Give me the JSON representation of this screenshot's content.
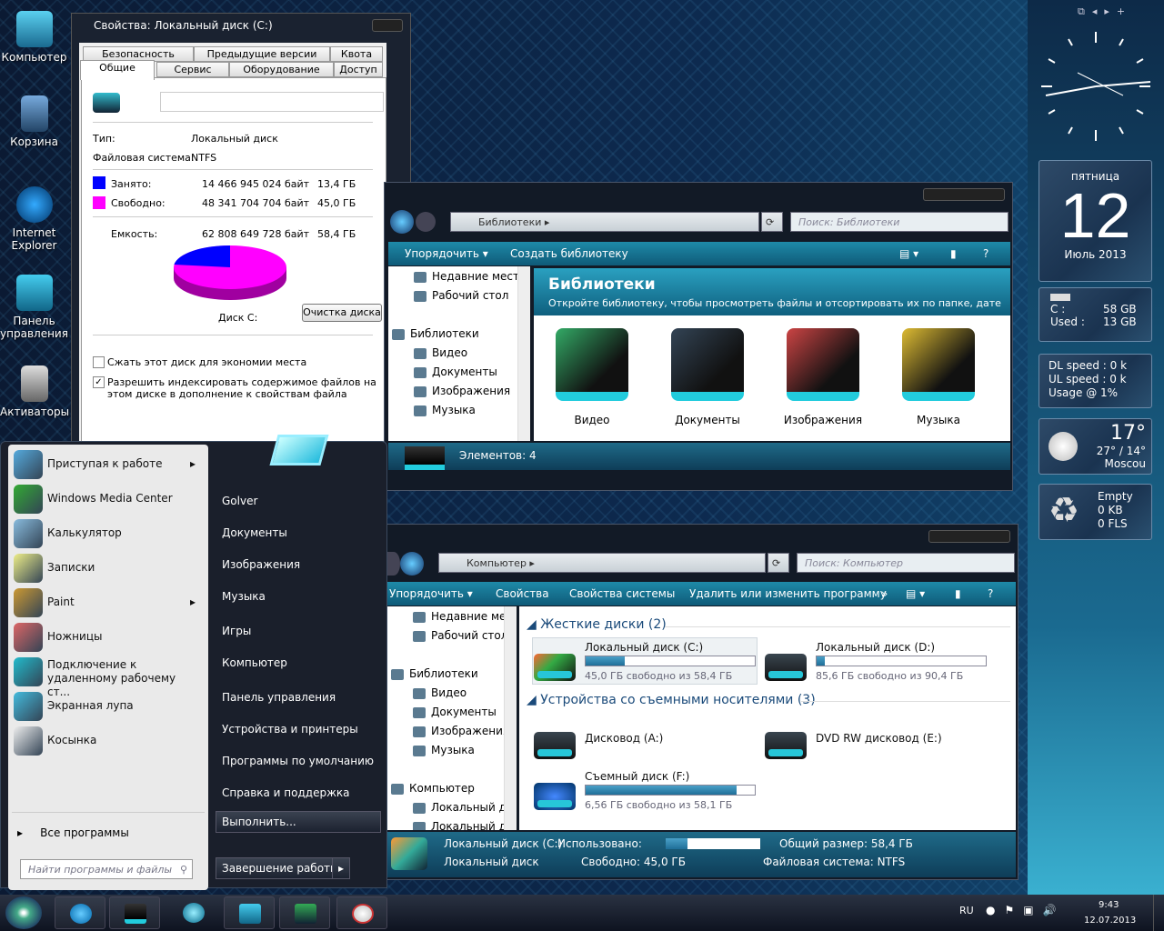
{
  "desktop": {
    "icons": [
      {
        "label": "Компьютер"
      },
      {
        "label": "Корзина"
      },
      {
        "label": "Internet Explorer"
      },
      {
        "label": "Панель управления"
      },
      {
        "label": "Активаторы"
      }
    ]
  },
  "props": {
    "title": "Свойства: Локальный диск (C:)",
    "tabs_top": [
      "Безопасность",
      "Предыдущие версии",
      "Квота"
    ],
    "tabs_bottom": [
      "Общие",
      "Сервис",
      "Оборудование",
      "Доступ"
    ],
    "name_value": "",
    "type_label": "Тип:",
    "type_value": "Локальный диск",
    "fs_label": "Файловая система:",
    "fs_value": "NTFS",
    "used_label": "Занято:",
    "used_bytes": "14 466 945 024 байт",
    "used_gb": "13,4 ГБ",
    "used_color": "#0000ff",
    "free_label": "Свободно:",
    "free_bytes": "48 341 704 704 байт",
    "free_gb": "45,0 ГБ",
    "free_color": "#ff00ff",
    "cap_label": "Емкость:",
    "cap_bytes": "62 808 649 728 байт",
    "cap_gb": "58,4 ГБ",
    "used_fraction": 0.23,
    "disk_label": "Диск C:",
    "cleanup_button": "Очистка диска",
    "compress_label": "Сжать этот диск для экономии места",
    "compress_checked": false,
    "index_label": "Разрешить индексировать содержимое файлов на этом диске в дополнение к свойствам файла",
    "index_checked": true
  },
  "libwin": {
    "address": "Библиотеки",
    "search_placeholder": "Поиск: Библиотеки",
    "toolbar": [
      "Упорядочить ▾",
      "Создать библиотеку"
    ],
    "nav": [
      "Недавние места",
      "Рабочий стол",
      "Библиотеки",
      "Видео",
      "Документы",
      "Изображения",
      "Музыка"
    ],
    "header_title": "Библиотеки",
    "header_sub": "Откройте библиотеку, чтобы просмотреть файлы и отсортировать их по папке, дате ...",
    "items": [
      "Видео",
      "Документы",
      "Изображения",
      "Музыка"
    ],
    "status": "Элементов: 4"
  },
  "compwin": {
    "address": "Компьютер",
    "search_placeholder": "Поиск: Компьютер",
    "toolbar": [
      "Упорядочить ▾",
      "Свойства",
      "Свойства системы",
      "Удалить или изменить программу",
      "»"
    ],
    "nav": [
      "Недавние места",
      "Рабочий стол",
      "Библиотеки",
      "Видео",
      "Документы",
      "Изображения",
      "Музыка",
      "Компьютер",
      "Локальный диск",
      "Локальный диск"
    ],
    "group_hdd": "Жесткие диски (2)",
    "group_removable": "Устройства со съемными носителями (3)",
    "drives": [
      {
        "name": "Локальный диск (C:)",
        "info": "45,0 ГБ свободно из 58,4 ГБ",
        "used_fraction": 0.23
      },
      {
        "name": "Локальный диск (D:)",
        "info": "85,6 ГБ свободно из 90,4 ГБ",
        "used_fraction": 0.05
      }
    ],
    "removable": [
      {
        "name": "Дисковод (A:)"
      },
      {
        "name": "DVD RW дисковод (E:)"
      },
      {
        "name": "Съемный диск (F:)",
        "info": "6,56 ГБ свободно из 58,1 ГБ",
        "used_fraction": 0.89
      }
    ],
    "status": {
      "name": "Локальный диск (C:)",
      "used_label": "Использовано:",
      "total": "Общий размер: 58,4 ГБ",
      "type": "Локальный диск",
      "free": "Свободно: 45,0 ГБ",
      "fs": "Файловая система: NTFS",
      "used_fraction": 0.23
    }
  },
  "start": {
    "left": [
      "Приступая к работе",
      "Windows Media Center",
      "Калькулятор",
      "Записки",
      "Paint",
      "Ножницы",
      "Подключение к удаленному рабочему ст...",
      "Экранная лупа",
      "Косынка"
    ],
    "all_programs": "Все программы",
    "search_placeholder": "Найти программы и файлы",
    "right": [
      "Golver",
      "Документы",
      "Изображения",
      "Музыка",
      "Игры",
      "Компьютер",
      "Панель управления",
      "Устройства и принтеры",
      "Программы по умолчанию",
      "Справка и поддержка"
    ],
    "run": "Выполнить...",
    "shutdown": "Завершение работы"
  },
  "tray": {
    "lang": "RU",
    "time": "9:43",
    "date": "12.07.2013"
  },
  "gadgets": {
    "calendar": {
      "weekday": "пятница",
      "day": "12",
      "month": "Июль 2013"
    },
    "drive": {
      "c_label": "C :",
      "c_value": "58 GB",
      "used_label": "Used :",
      "used_value": "13 GB"
    },
    "net": {
      "dl": "DL speed : 0 k",
      "ul": "UL speed : 0 k",
      "usage": "Usage @ 1%"
    },
    "weather": {
      "temp": "17°",
      "range": "27° / 14°",
      "city": "Moscou"
    },
    "recycle": {
      "state": "Empty",
      "size": "0 KB",
      "files": "0 FLS"
    }
  }
}
